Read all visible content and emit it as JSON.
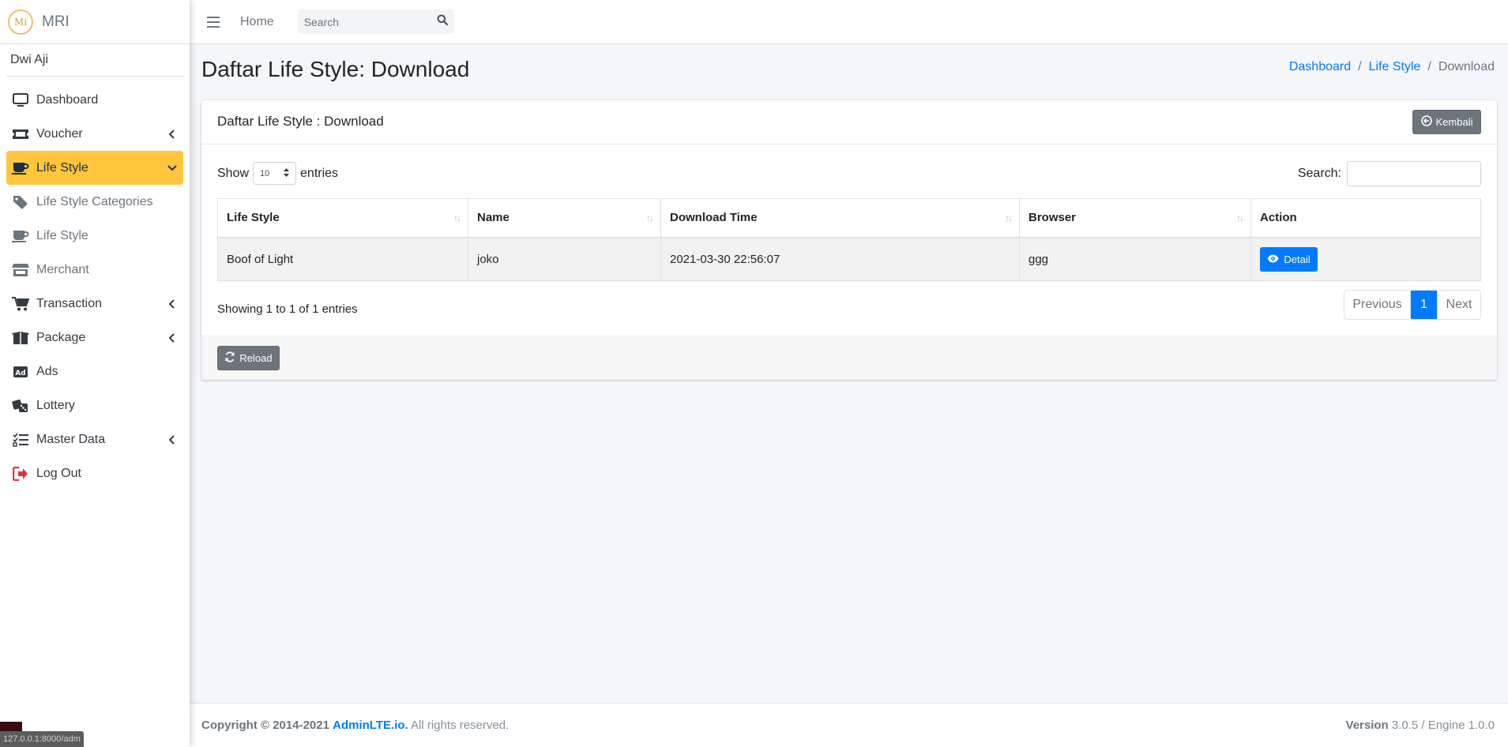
{
  "brand": {
    "logo_text": "Mi",
    "name": "MRI"
  },
  "user": {
    "name": "Dwi Aji"
  },
  "sidebar": {
    "items": [
      {
        "label": "Dashboard"
      },
      {
        "label": "Voucher"
      },
      {
        "label": "Life Style"
      },
      {
        "label": "Life Style Categories"
      },
      {
        "label": "Life Style"
      },
      {
        "label": "Merchant"
      },
      {
        "label": "Transaction"
      },
      {
        "label": "Package"
      },
      {
        "label": "Ads"
      },
      {
        "label": "Lottery"
      },
      {
        "label": "Master Data"
      },
      {
        "label": "Log Out"
      }
    ]
  },
  "topbar": {
    "home_label": "Home",
    "search_placeholder": "Search"
  },
  "page": {
    "title": "Daftar Life Style: Download",
    "breadcrumb": [
      "Dashboard",
      "Life Style",
      "Download"
    ]
  },
  "card": {
    "title": "Daftar Life Style : Download",
    "back_label": "Kembali",
    "show_label": "Show",
    "entries_value": "10",
    "entries_label": "entries",
    "search_label": "Search:",
    "columns": [
      "Life Style",
      "Name",
      "Download Time",
      "Browser",
      "Action"
    ],
    "rows": [
      {
        "life_style": "Boof of Light",
        "name": "joko",
        "download_time": "2021-03-30 22:56:07",
        "browser": "ggg",
        "action_label": "Detail"
      }
    ],
    "info": "Showing 1 to 1 of 1 entries",
    "pagination": {
      "previous": "Previous",
      "current": "1",
      "next": "Next"
    },
    "reload_label": "Reload"
  },
  "footer": {
    "copyright_prefix": "Copyright © 2014-2021",
    "link_text": "AdminLTE.io.",
    "rights": "All rights reserved.",
    "version_label": "Version",
    "version_value": "3.0.5 / Engine 1.0.0"
  },
  "status_bar": {
    "url": "127.0.0.1:8000/adm"
  },
  "colors": {
    "active_nav": "#ffc53d",
    "primary": "#007bff",
    "secondary": "#6c757d",
    "logout_icon": "#dc3545"
  }
}
